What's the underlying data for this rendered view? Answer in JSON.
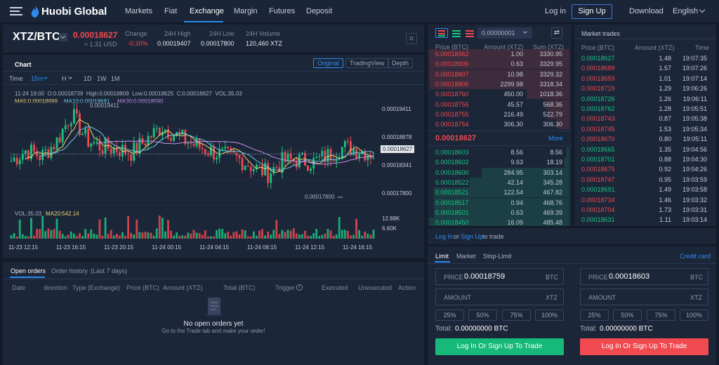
{
  "nav": {
    "logo": "Huobi Global",
    "items": [
      "Markets",
      "Fiat",
      "Exchange",
      "Margin",
      "Futures",
      "Deposit"
    ],
    "login": "Log in",
    "signup": "Sign Up",
    "download": "Download",
    "language": "English"
  },
  "ticker": {
    "pair": "XTZ/BTC",
    "price": "0.00018627",
    "usd": "≈ 1.31 USD",
    "stats": [
      {
        "label": "Change",
        "value": "-0.30%"
      },
      {
        "label": "24H High",
        "value": "0.00019407"
      },
      {
        "label": "24H Low",
        "value": "0.00017800"
      },
      {
        "label": "24H Volume",
        "value": "120,460 XTZ"
      }
    ]
  },
  "chart": {
    "title": "Chart",
    "views": [
      "Original",
      "TradingView",
      "Depth"
    ],
    "time_label": "Time",
    "intervals": [
      "15m",
      "H",
      "1D",
      "1W",
      "1M"
    ],
    "ohlc": "11-24 19:00  O:0.00018739  High:0.00018809  Low:0.00018625  C:0.00018627  VOL:35.03",
    "ma5": "MA5:0.00018699",
    "ma10": "MA10:0.00018681",
    "ma30": "MA30:0.00018590",
    "high_mark": "0.00019411",
    "low_mark": "0.00017800",
    "current_tag": "0.00018627",
    "y_labels": [
      "0.00019411",
      "0.00018878",
      "0.00018341",
      "0.00017800"
    ],
    "vol_label": "VOL:35.03",
    "vol_ma20": "MA20:542.14",
    "vol_y_labels": [
      "12.88K",
      "6.60K"
    ],
    "x_labels": [
      "11-23 12:15",
      "11-23 16:15",
      "11-23 20:15",
      "11-24 00:15",
      "11-24 04:15",
      "11-24 08:15",
      "11-24 12:15",
      "11-24 16:15"
    ]
  },
  "chart_data": {
    "type": "candlestick",
    "interval": "15m",
    "ylim": [
      0.000177,
      0.0001955
    ],
    "markers": {
      "high": 0.00019411,
      "low": 0.000178,
      "current": 0.00018627
    },
    "volume_ylim": [
      0,
      14000
    ]
  },
  "orderbook": {
    "precision": "0.00000001",
    "headers": [
      "Price (BTC)",
      "Amount (XTZ)",
      "Sum (XTZ)"
    ],
    "asks": [
      [
        "0.00018962",
        "1.00",
        "3330.95"
      ],
      [
        "0.00018906",
        "0.63",
        "3329.95"
      ],
      [
        "0.00018807",
        "10.98",
        "3329.32"
      ],
      [
        "0.00018806",
        "2299.98",
        "3318.34"
      ],
      [
        "0.00018760",
        "450.00",
        "1018.36"
      ],
      [
        "0.00018756",
        "45.57",
        "568.36"
      ],
      [
        "0.00018755",
        "216.49",
        "522.79"
      ],
      [
        "0.00018754",
        "306.30",
        "306.30"
      ]
    ],
    "last_price": "0.00018627",
    "more": "More",
    "bids": [
      [
        "0.00018603",
        "8.56",
        "8.56"
      ],
      [
        "0.00018602",
        "9.63",
        "18.19"
      ],
      [
        "0.00018600",
        "284.95",
        "303.14"
      ],
      [
        "0.00018522",
        "42.14",
        "345.28"
      ],
      [
        "0.00018521",
        "122.54",
        "467.82"
      ],
      [
        "0.00018517",
        "0.94",
        "468.76"
      ],
      [
        "0.00018501",
        "0.63",
        "469.39"
      ],
      [
        "0.00018450",
        "16.09",
        "485.48"
      ]
    ]
  },
  "trades": {
    "title": "Market trades",
    "headers": [
      "Price (BTC)",
      "Amount (XTZ)",
      "Time"
    ],
    "rows": [
      [
        "0.00018627",
        "1.48",
        "19:07:35",
        "g"
      ],
      [
        "0.00018689",
        "1.57",
        "19:07:26",
        "r"
      ],
      [
        "0.00018659",
        "1.01",
        "19:07:14",
        "r"
      ],
      [
        "0.00018719",
        "1.29",
        "19:06:26",
        "r"
      ],
      [
        "0.00018726",
        "1.26",
        "19:06:11",
        "g"
      ],
      [
        "0.00018762",
        "1.28",
        "19:05:51",
        "g"
      ],
      [
        "0.00018743",
        "0.87",
        "19:05:38",
        "r"
      ],
      [
        "0.00018745",
        "1.53",
        "19:05:34",
        "r"
      ],
      [
        "0.00018670",
        "0.80",
        "19:05:11",
        "r"
      ],
      [
        "0.00018665",
        "1.35",
        "19:04:56",
        "g"
      ],
      [
        "0.00018701",
        "0.88",
        "19:04:30",
        "g"
      ],
      [
        "0.00018675",
        "0.92",
        "19:04:26",
        "r"
      ],
      [
        "0.00018747",
        "0.95",
        "19:03:59",
        "r"
      ],
      [
        "0.00018691",
        "1.49",
        "19:03:58",
        "g"
      ],
      [
        "0.00018734",
        "1.46",
        "19:03:32",
        "r"
      ],
      [
        "0.00018704",
        "1.73",
        "19:03:31",
        "r"
      ],
      [
        "0.00018631",
        "1.11",
        "19:03:14",
        "g"
      ]
    ]
  },
  "orders": {
    "tab_open": "Open orders",
    "tab_history": "Order history",
    "history_note": "(Last 7 days)",
    "columns": [
      "Date",
      "direction",
      "Type (Exchange)",
      "Price (BTC)",
      "Amount (XTZ)",
      "Total (BTC)",
      "Trigger",
      "Executed",
      "Unexecuted",
      "Action"
    ],
    "empty_title": "No open orders yet",
    "empty_sub": "Go to the Trade tab and make your order!"
  },
  "trade_form": {
    "login_prompt_a": "Log In",
    "login_prompt_or": "or",
    "login_prompt_b": "Sign Up",
    "login_prompt_c": "to trade",
    "tabs": [
      "Limit",
      "Market",
      "Stop-Limit"
    ],
    "credit": "Credit card",
    "price_label": "PRICE",
    "amount_label": "AMOUNT",
    "buy_price": "0.00018759",
    "sell_price": "0.00018603",
    "price_unit": "BTC",
    "amount_unit": "XTZ",
    "percents": [
      "25%",
      "50%",
      "75%",
      "100%"
    ],
    "total_label": "Total:",
    "total_value": "0.00000000 BTC",
    "buy_button": "Log In Or Sign Up To Trade",
    "sell_button": "Log In Or Sign Up To Trade"
  }
}
